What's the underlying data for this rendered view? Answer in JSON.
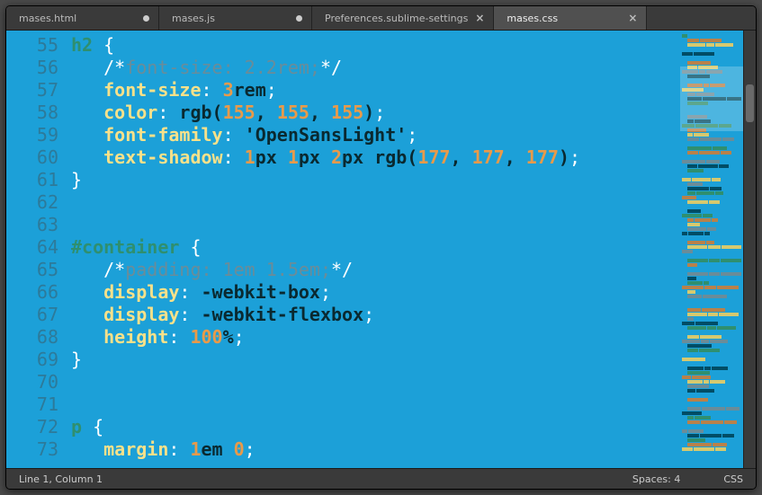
{
  "tabs": [
    {
      "label": "mases.html",
      "dirty": true,
      "active": false
    },
    {
      "label": "mases.js",
      "dirty": true,
      "active": false
    },
    {
      "label": "Preferences.sublime-settings",
      "dirty": false,
      "active": false
    },
    {
      "label": "mases.css",
      "dirty": false,
      "active": true
    }
  ],
  "gutter_start": 55,
  "gutter_end": 73,
  "code_lines": [
    {
      "n": 55,
      "indent": 0,
      "kind": "selector_open",
      "selector": "h2"
    },
    {
      "n": 56,
      "indent": 1,
      "kind": "comment",
      "open": "/*",
      "prop": "font-size",
      "sep": ": ",
      "value": "2.2rem;",
      "close": "*/"
    },
    {
      "n": 57,
      "indent": 1,
      "kind": "decl",
      "prop": "font-size",
      "parts": [
        {
          "t": "num",
          "v": "3"
        },
        {
          "t": "unit",
          "v": "rem"
        }
      ]
    },
    {
      "n": 58,
      "indent": 1,
      "kind": "decl",
      "prop": "color",
      "parts": [
        {
          "t": "func",
          "v": "rgb"
        },
        {
          "t": "punct",
          "v": "("
        },
        {
          "t": "num",
          "v": "155"
        },
        {
          "t": "punct",
          "v": ", "
        },
        {
          "t": "num",
          "v": "155"
        },
        {
          "t": "punct",
          "v": ", "
        },
        {
          "t": "num",
          "v": "155"
        },
        {
          "t": "punct",
          "v": ")"
        }
      ]
    },
    {
      "n": 59,
      "indent": 1,
      "kind": "decl",
      "prop": "font-family",
      "parts": [
        {
          "t": "str",
          "v": "'OpenSansLight'"
        }
      ]
    },
    {
      "n": 60,
      "indent": 1,
      "kind": "decl",
      "prop": "text-shadow",
      "parts": [
        {
          "t": "num",
          "v": "1"
        },
        {
          "t": "unit",
          "v": "px "
        },
        {
          "t": "num",
          "v": "1"
        },
        {
          "t": "unit",
          "v": "px "
        },
        {
          "t": "num",
          "v": "2"
        },
        {
          "t": "unit",
          "v": "px "
        },
        {
          "t": "func",
          "v": "rgb"
        },
        {
          "t": "punct",
          "v": "("
        },
        {
          "t": "num",
          "v": "177"
        },
        {
          "t": "punct",
          "v": ", "
        },
        {
          "t": "num",
          "v": "177"
        },
        {
          "t": "punct",
          "v": ", "
        },
        {
          "t": "num",
          "v": "177"
        },
        {
          "t": "punct",
          "v": ")"
        }
      ]
    },
    {
      "n": 61,
      "indent": 0,
      "kind": "close"
    },
    {
      "n": 62,
      "indent": 0,
      "kind": "blank"
    },
    {
      "n": 63,
      "indent": 0,
      "kind": "blank"
    },
    {
      "n": 64,
      "indent": 0,
      "kind": "selector_open",
      "selector": "#container"
    },
    {
      "n": 65,
      "indent": 1,
      "kind": "comment",
      "open": "/*",
      "prop": "padding",
      "sep": ": ",
      "value": "1em 1.5em;",
      "close": "*/"
    },
    {
      "n": 66,
      "indent": 1,
      "kind": "decl",
      "prop": "display",
      "parts": [
        {
          "t": "val",
          "v": "-webkit-box"
        }
      ]
    },
    {
      "n": 67,
      "indent": 1,
      "kind": "decl",
      "prop": "display",
      "parts": [
        {
          "t": "val",
          "v": "-webkit-flexbox"
        }
      ]
    },
    {
      "n": 68,
      "indent": 1,
      "kind": "decl",
      "prop": "height",
      "parts": [
        {
          "t": "num",
          "v": "100"
        },
        {
          "t": "unit",
          "v": "%"
        }
      ]
    },
    {
      "n": 69,
      "indent": 0,
      "kind": "close"
    },
    {
      "n": 70,
      "indent": 0,
      "kind": "blank"
    },
    {
      "n": 71,
      "indent": 0,
      "kind": "blank"
    },
    {
      "n": 72,
      "indent": 0,
      "kind": "selector_open",
      "selector": "p"
    },
    {
      "n": 73,
      "indent": 1,
      "kind": "decl",
      "prop": "margin",
      "parts": [
        {
          "t": "num",
          "v": "1"
        },
        {
          "t": "unit",
          "v": "em "
        },
        {
          "t": "num",
          "v": "0"
        }
      ]
    }
  ],
  "status": {
    "left": "Line 1, Column 1",
    "spaces": "Spaces: 4",
    "syntax": "CSS"
  }
}
